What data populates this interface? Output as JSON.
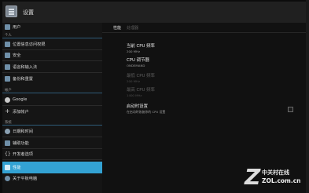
{
  "app": {
    "title": "设置"
  },
  "sidebar": {
    "items": [
      {
        "kind": "item",
        "label": "用户",
        "icon": "user-icon",
        "top": 0
      },
      {
        "kind": "header",
        "label": "个人"
      },
      {
        "kind": "item",
        "label": "位置信息访问权限",
        "icon": "location-icon"
      },
      {
        "kind": "item",
        "label": "安全",
        "icon": "lock-icon"
      },
      {
        "kind": "item",
        "label": "语言和输入法",
        "icon": "language-icon"
      },
      {
        "kind": "item",
        "label": "备份和重置",
        "icon": "backup-icon"
      },
      {
        "kind": "header",
        "label": "帐户"
      },
      {
        "kind": "item",
        "label": "Google",
        "icon": "google-icon"
      },
      {
        "kind": "item",
        "label": "添加帐户",
        "icon": "add-icon"
      },
      {
        "kind": "header",
        "label": "系统"
      },
      {
        "kind": "item",
        "label": "日期和时间",
        "icon": "clock-icon"
      },
      {
        "kind": "item",
        "label": "辅助功能",
        "icon": "accessibility-icon"
      },
      {
        "kind": "item",
        "label": "开发者选项",
        "icon": "developer-icon"
      },
      {
        "kind": "item",
        "label": "性能",
        "icon": "performance-icon",
        "active": true
      },
      {
        "kind": "item",
        "label": "关于平板电脑",
        "icon": "info-icon"
      }
    ]
  },
  "content": {
    "tabs": [
      "性能",
      "处理器"
    ],
    "prefs": [
      {
        "title": "当前 CPU 频率",
        "summary": "200 MHz",
        "disabled": false
      },
      {
        "title": "CPU 调节器",
        "summary": "ONDEMAND",
        "disabled": false
      },
      {
        "title": "最低 CPU 频率",
        "summary": "200 MHz",
        "disabled": true
      },
      {
        "title": "最高 CPU 频率",
        "summary": "1400 MHz",
        "disabled": true
      },
      {
        "title": "启动时设置",
        "summary": "在启动时恢复你的 CPU 设置",
        "disabled": false,
        "checkbox": false
      }
    ]
  },
  "watermark": {
    "cn": "中关村在线",
    "url": "ZOL.com.cn"
  },
  "colors": {
    "accent": "#33a2d3",
    "background": "#0c0c0c"
  }
}
